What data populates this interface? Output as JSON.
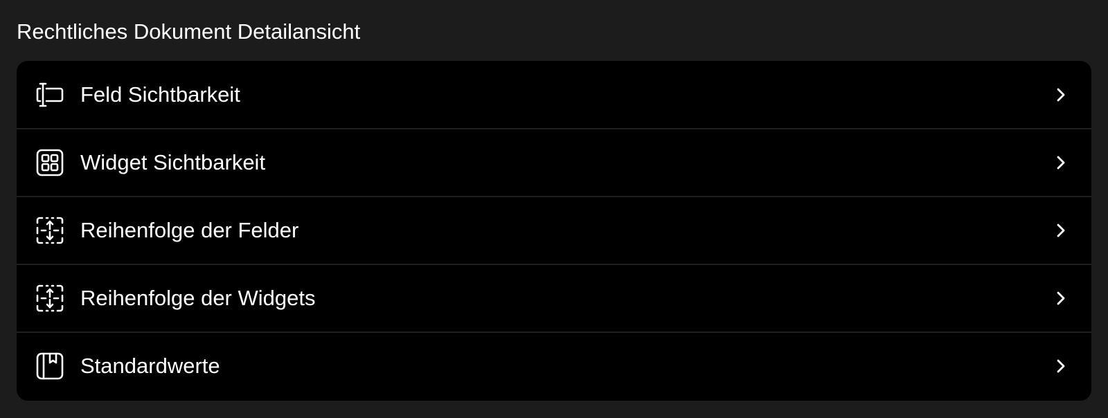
{
  "section": {
    "title": "Rechtliches Dokument Detailansicht"
  },
  "items": [
    {
      "label": "Feld Sichtbarkeit",
      "icon": "text-cursor-field-icon"
    },
    {
      "label": "Widget Sichtbarkeit",
      "icon": "widgets-grid-icon"
    },
    {
      "label": "Reihenfolge der Felder",
      "icon": "reorder-arrows-icon"
    },
    {
      "label": "Reihenfolge der Widgets",
      "icon": "reorder-arrows-icon"
    },
    {
      "label": "Standardwerte",
      "icon": "bookmark-box-icon"
    }
  ],
  "colors": {
    "background": "#1c1c1c",
    "card": "#000000",
    "text": "#ffffff",
    "divider": "#202020"
  }
}
